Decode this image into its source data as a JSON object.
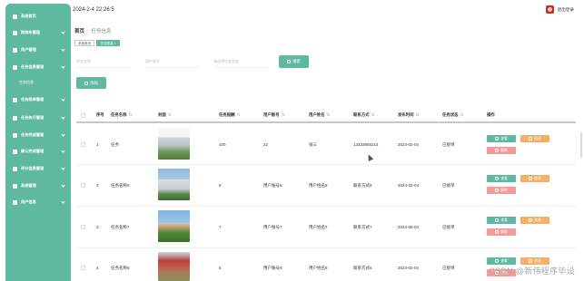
{
  "header": {
    "datetime": "2024-2-4 22:26:5",
    "user_name": "退出登录"
  },
  "sidebar": {
    "items": [
      {
        "label": "系统首页",
        "icon": "home-icon",
        "submenu": false
      },
      {
        "label": "购物车管理",
        "icon": "cart-icon",
        "submenu": true
      },
      {
        "label": "用户管理",
        "icon": "user-icon",
        "submenu": true
      },
      {
        "label": "任务信息管理",
        "icon": "grid-icon",
        "submenu": true
      },
      {
        "label": "任务接单管理",
        "icon": "folder-icon",
        "submenu": true
      },
      {
        "label": "任务执行管理",
        "icon": "grid-icon",
        "submenu": true
      },
      {
        "label": "任务完成管理",
        "icon": "grid-icon",
        "submenu": true
      },
      {
        "label": "确认完成管理",
        "icon": "grid-icon",
        "submenu": true
      },
      {
        "label": "评价信息管理",
        "icon": "list-icon",
        "submenu": true
      },
      {
        "label": "系统管理",
        "icon": "grid-icon",
        "submenu": true
      },
      {
        "label": "用户信息",
        "icon": "card-icon",
        "submenu": true
      }
    ],
    "active_sub": "任务信息"
  },
  "breadcrumb": {
    "home": "首页",
    "current": "任务信息"
  },
  "tags": [
    "系统首页",
    "任务信息 ×"
  ],
  "search": {
    "fields": [
      "任务名称",
      "用户账号",
      "请选择任务状态"
    ],
    "search_label": "搜索",
    "add_label": "添加"
  },
  "table": {
    "headers": [
      "序号",
      "任务名称",
      "封面",
      "任务报酬",
      "用户账号",
      "用户姓名",
      "联系方式",
      "发布时间",
      "任务状态",
      "操作"
    ],
    "actions": {
      "view": "查看",
      "edit": "修改",
      "delete": "删除"
    },
    "rows": [
      {
        "index": "1",
        "name": "任务",
        "reward": "100",
        "account": "22",
        "username": "张三",
        "phone": "13333665214",
        "date": "2024-02-04",
        "status": "已接单"
      },
      {
        "index": "2",
        "name": "任务名称8",
        "reward": "8",
        "account": "用户账号8",
        "username": "用户姓名8",
        "phone": "联系方式8",
        "date": "2024-02-04",
        "status": "已接单"
      },
      {
        "index": "3",
        "name": "任务名称7",
        "reward": "7",
        "account": "用户账号7",
        "username": "用户姓名7",
        "phone": "联系方式7",
        "date": "2024-02-04",
        "status": "已接单"
      },
      {
        "index": "4",
        "name": "任务名称6",
        "reward": "6",
        "account": "用户账号6",
        "username": "用户姓名6",
        "phone": "联系方式6",
        "date": "2024-02-04",
        "status": "已接单"
      }
    ]
  },
  "watermark": "CSDN @新伟程序毕设"
}
